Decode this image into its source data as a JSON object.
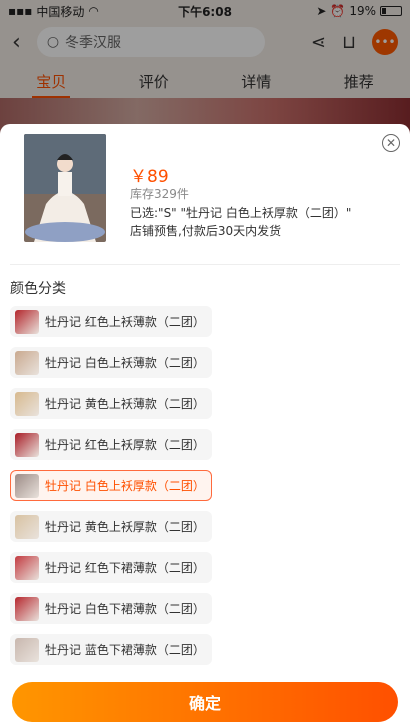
{
  "status_bar": {
    "carrier": "中国移动",
    "time": "下午6:08",
    "battery": "19%"
  },
  "nav": {
    "search_text": "冬季汉服"
  },
  "tabs": [
    {
      "label": "宝贝",
      "active": true
    },
    {
      "label": "评价",
      "active": false
    },
    {
      "label": "详情",
      "active": false
    },
    {
      "label": "推荐",
      "active": false
    }
  ],
  "sheet": {
    "price": "￥89",
    "stock": "库存329件",
    "selected": "已选:\"S\" \"牡丹记 白色上袄厚款（二团）\"",
    "shipping": "店铺预售,付款后30天内发货",
    "section_title": "颜色分类",
    "options": [
      {
        "label": "牡丹记 红色上袄薄款（二团）",
        "swatch": "#b3262c",
        "selected": false
      },
      {
        "label": "牡丹记 白色上袄薄款（二团）",
        "swatch": "#c9a98f",
        "selected": false
      },
      {
        "label": "牡丹记 黄色上袄薄款（二团）",
        "swatch": "#d7b98e",
        "selected": false
      },
      {
        "label": "牡丹记 红色上袄厚款（二团）",
        "swatch": "#a81d27",
        "selected": false
      },
      {
        "label": "牡丹记 白色上袄厚款（二团）",
        "swatch": "#9c8b86",
        "selected": true
      },
      {
        "label": "牡丹记 黄色上袄厚款（二团）",
        "swatch": "#d8c2a2",
        "selected": false
      },
      {
        "label": "牡丹记 红色下裙薄款（二团）",
        "swatch": "#c23a40",
        "selected": false
      },
      {
        "label": "牡丹记 白色下裙薄款（二团）",
        "swatch": "#b6272e",
        "selected": false
      },
      {
        "label": "牡丹记 蓝色下裙薄款（二团）",
        "swatch": "#c8b7ae",
        "selected": false
      }
    ],
    "confirm_label": "确定"
  },
  "colors": {
    "accent": "#ff5000",
    "button_start": "#ff9600",
    "button_end": "#ff5000"
  }
}
